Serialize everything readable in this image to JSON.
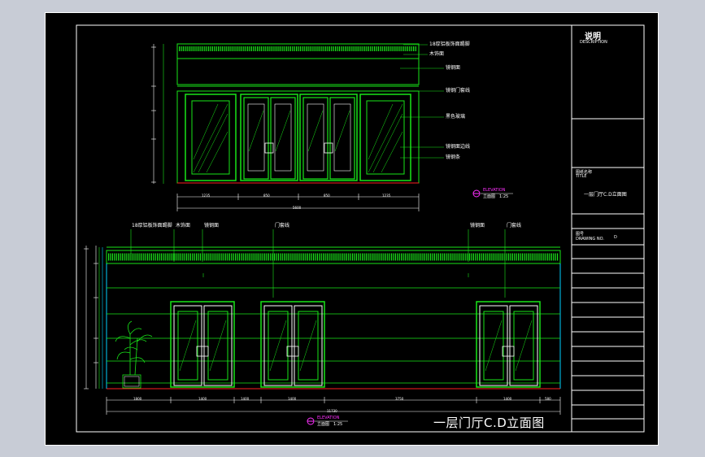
{
  "title_block": {
    "heading": "说明",
    "heading_en": "DESCRIPTION",
    "title_label": "图纸名称",
    "title_label_en": "TITLE",
    "title_value": "一层门厅C.D立面图",
    "drawing_no_label": "图号",
    "drawing_no_label_en": "DRAWING NO.",
    "drawing_no_value": "D"
  },
  "upper_elevation": {
    "marker_en": "ELEVATION",
    "marker_cn": "立面图",
    "scale": "1:25",
    "callouts": [
      "18厚铝板饰面踢脚",
      "木饰面",
      "镜钢面",
      "镜钢门套线",
      "黑色玻璃",
      "镜钢面边线",
      "镜钢条"
    ],
    "dimensions": [
      "1235",
      "850",
      "850",
      "1235"
    ],
    "total_dimension": "5600"
  },
  "lower_elevation": {
    "marker_en": "ELEVATION",
    "marker_cn": "立面图",
    "scale": "1:25",
    "callouts": [
      "18厚铝板饰面踢脚",
      "木饰面",
      "镜钢面",
      "门套线",
      "镜钢面",
      "门套线"
    ],
    "dimensions": [
      "1800",
      "1400",
      "1400",
      "1400",
      "3750",
      "1400",
      "580"
    ],
    "total_dimension": "11730"
  },
  "sheet_title": "一层门厅C.D立面图",
  "colors": {
    "line_green": "#19e619",
    "line_cyan": "#00d0ff",
    "line_white": "#ffffff",
    "line_red": "#ff2020",
    "line_magenta": "#ff30ff",
    "background": "#000000"
  }
}
